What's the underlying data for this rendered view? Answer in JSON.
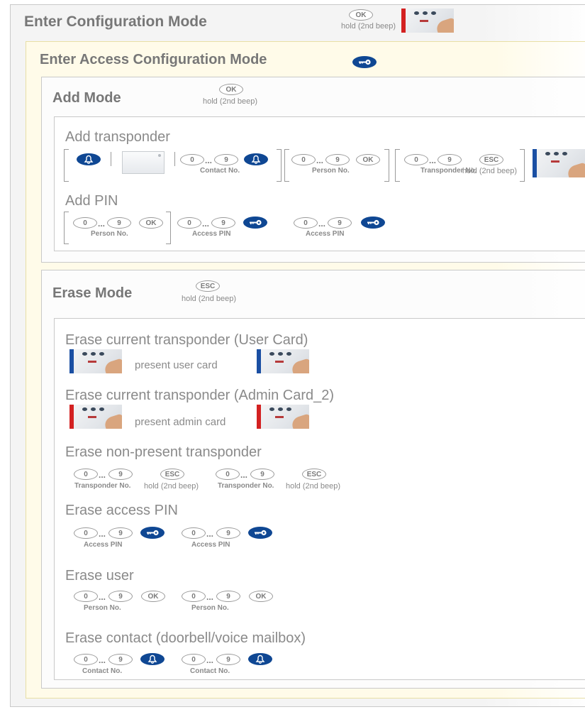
{
  "colors": {
    "accent_blue": "#0f4793",
    "user_card_blue": "#1a4fa3",
    "admin_card_red": "#d32121",
    "text_gray": "#8a8a8a"
  },
  "icons": {
    "bell": "bell-icon",
    "key": "key-icon",
    "reader": "card-reader-image"
  },
  "keys": {
    "ok": "OK",
    "esc": "ESC",
    "zero": "0",
    "nine": "9",
    "dots": "..."
  },
  "hold": "hold (2nd beep)",
  "enter_config": {
    "title": "Enter Configuration Mode"
  },
  "access_config": {
    "title": "Enter Access Configuration Mode"
  },
  "add_mode": {
    "title": "Add Mode",
    "add_transponder": {
      "title": "Add transponder",
      "contact_no": "Contact No.",
      "person_no": "Person No.",
      "transponder_no": "Transponder No."
    },
    "add_pin": {
      "title": "Add PIN",
      "person_no": "Person No.",
      "access_pin": "Access PIN"
    }
  },
  "erase_mode": {
    "title": "Erase Mode",
    "user_card": {
      "title": "Erase current transponder (User Card)",
      "present": "present user card"
    },
    "admin_card": {
      "title": "Erase current transponder (Admin Card_2)",
      "present": "present admin card"
    },
    "non_present": {
      "title": "Erase non-present transponder",
      "transponder_no": "Transponder No."
    },
    "access_pin": {
      "title": "Erase access PIN",
      "access_pin": "Access PIN"
    },
    "user": {
      "title": "Erase user",
      "person_no": "Person No."
    },
    "contact": {
      "title": "Erase contact (doorbell/voice mailbox)",
      "contact_no": "Contact No."
    }
  }
}
